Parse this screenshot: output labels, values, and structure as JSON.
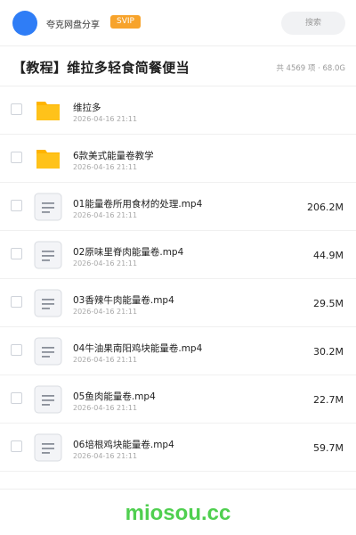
{
  "header": {
    "brand": "夸克网盘分享",
    "badge": "SVIP",
    "search_placeholder": "搜索"
  },
  "share": {
    "title": "【教程】维拉多轻食简餐便当",
    "meta": "共 4569 项 · 68.0G"
  },
  "items": [
    {
      "type": "folder",
      "name": "维拉多",
      "date": "2026-04-16 21:11",
      "size": ""
    },
    {
      "type": "folder",
      "name": "6款美式能量卷教学",
      "date": "2026-04-16 21:11",
      "size": ""
    },
    {
      "type": "file",
      "name": "01能量卷所用食材的处理.mp4",
      "date": "2026-04-16 21:11",
      "size": "206.2M"
    },
    {
      "type": "file",
      "name": "02原味里脊肉能量卷.mp4",
      "date": "2026-04-16 21:11",
      "size": "44.9M"
    },
    {
      "type": "file",
      "name": "03香辣牛肉能量卷.mp4",
      "date": "2026-04-16 21:11",
      "size": "29.5M"
    },
    {
      "type": "file",
      "name": "04牛油果南阳鸡块能量卷.mp4",
      "date": "2026-04-16 21:11",
      "size": "30.2M"
    },
    {
      "type": "file",
      "name": "05鱼肉能量卷.mp4",
      "date": "2026-04-16 21:11",
      "size": "22.7M"
    },
    {
      "type": "file",
      "name": "06培根鸡块能量卷.mp4",
      "date": "2026-04-16 21:11",
      "size": "59.7M"
    }
  ],
  "watermark": "miosou.cc",
  "colors": {
    "accent": "#2f7df6",
    "badge": "#f7a32b",
    "folder": "#ffc21a",
    "watermark": "#4fcf4f"
  }
}
